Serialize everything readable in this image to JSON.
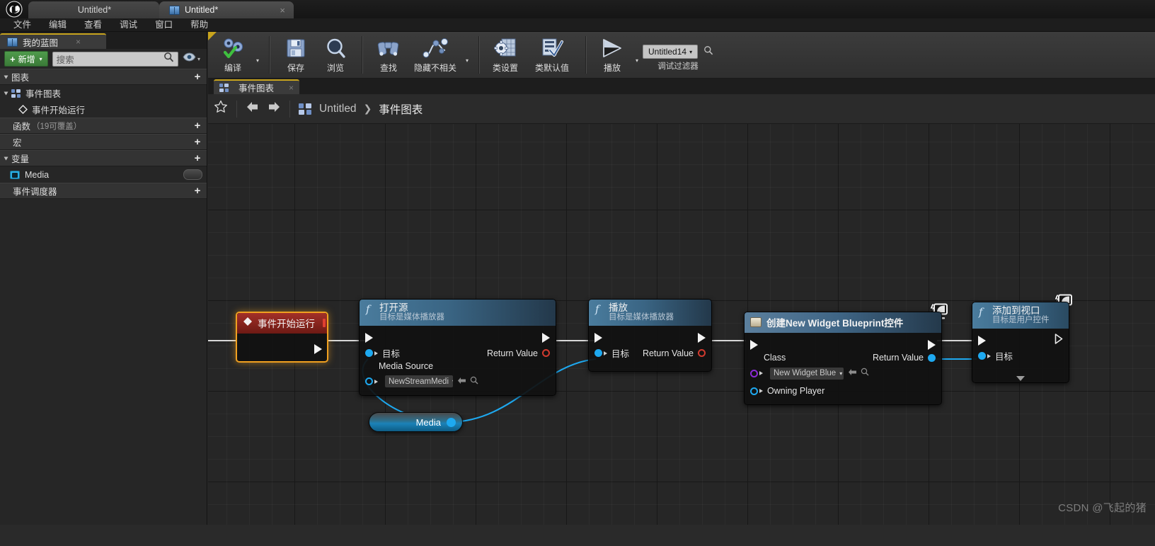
{
  "app": {
    "logo_icon": "unreal-engine-logo",
    "window_tabs": [
      {
        "label": "Untitled*",
        "icon": "unreal-window-icon",
        "active": false
      },
      {
        "label": "Untitled*",
        "icon": "blueprint-book-icon",
        "active": true,
        "close": "×"
      }
    ]
  },
  "menubar": {
    "items": [
      "文件",
      "编辑",
      "查看",
      "调试",
      "窗口",
      "帮助"
    ]
  },
  "left_panel": {
    "tab": {
      "label": "我的蓝图",
      "icon": "blueprint-book-icon",
      "close": "×"
    },
    "add_button": {
      "label": "新增",
      "plus": "+",
      "caret": "▾"
    },
    "search": {
      "placeholder": "搜索",
      "icon": "search-icon"
    },
    "eye": {
      "icon": "eye-icon",
      "caret": "▾"
    },
    "sections": [
      {
        "name": "graphs",
        "label": "图表",
        "plus": "+"
      },
      {
        "name": "event-graph",
        "label": "事件图表",
        "icon": "event-graph-icon"
      },
      {
        "name": "event-begin-play",
        "label": "事件开始运行",
        "icon": "event-node-icon"
      },
      {
        "name": "functions",
        "label": "函数",
        "note": "（19可覆盖）",
        "plus": "+"
      },
      {
        "name": "macros",
        "label": "宏",
        "plus": "+"
      },
      {
        "name": "variables",
        "label": "变量",
        "plus": "+"
      },
      {
        "name": "variable-media",
        "label": "Media",
        "icon": "media-player-icon"
      },
      {
        "name": "event-dispatchers",
        "label": "事件调度器",
        "plus": "+"
      }
    ]
  },
  "toolbar": {
    "buttons": [
      {
        "name": "compile",
        "label": "编译",
        "icon": "compile-gears-check-icon",
        "caret": "▾"
      },
      {
        "name": "save",
        "label": "保存",
        "icon": "save-floppy-icon"
      },
      {
        "name": "browse",
        "label": "浏览",
        "icon": "browse-magnifier-icon"
      },
      {
        "name": "find",
        "label": "查找",
        "icon": "find-binoculars-icon"
      },
      {
        "name": "hide-unrelated",
        "label": "隐藏不相关",
        "icon": "hide-unrelated-nodes-icon",
        "caret": "▾"
      },
      {
        "name": "class-settings",
        "label": "类设置",
        "icon": "class-settings-icon"
      },
      {
        "name": "class-defaults",
        "label": "类默认值",
        "icon": "class-defaults-icon"
      },
      {
        "name": "play",
        "label": "播放",
        "icon": "play-triangle-icon",
        "caret": "▾"
      }
    ],
    "debug": {
      "value": "Untitled14",
      "caret": "▾",
      "label": "调试过滤器",
      "search_icon": "search-icon"
    }
  },
  "graph_tab": {
    "label": "事件图表",
    "icon": "event-graph-icon",
    "close": "×"
  },
  "breadcrumb": {
    "star_icon": "favorite-star-icon",
    "back_icon": "back-arrow-icon",
    "forward_icon": "forward-arrow-icon",
    "graph_icon": "event-graph-icon",
    "root": "Untitled",
    "chevron": "❯",
    "current": "事件图表"
  },
  "graph": {
    "watermark": "CSDN @飞起的猪",
    "nodes": [
      {
        "name": "event-begin-play-node",
        "title": "事件开始运行",
        "header_icon": "event-diamond-icon",
        "badge_icon": "red-square-icon",
        "selected": true
      },
      {
        "name": "open-source-node",
        "title": "打开源",
        "subtitle": "目标是媒体播放器",
        "header_icon": "function-f-icon",
        "pins": {
          "target": "目标",
          "media_source": "Media Source",
          "return_value": "Return Value"
        },
        "media_source_value": "NewStreamMedi",
        "caret": "▾",
        "mini_icons": [
          "use-selected-asset-icon",
          "browse-to-asset-icon"
        ]
      },
      {
        "name": "play-node",
        "title": "播放",
        "subtitle": "目标是媒体播放器",
        "header_icon": "function-f-icon",
        "pins": {
          "target": "目标",
          "return_value": "Return Value"
        }
      },
      {
        "name": "create-widget-node",
        "title": "创建New Widget Blueprint控件",
        "header_icon": "widget-blueprint-icon",
        "pins": {
          "class": "Class",
          "owning_player": "Owning Player",
          "return_value": "Return Value"
        },
        "class_value": "New Widget Blue",
        "caret": "▾",
        "mini_icons": [
          "use-selected-asset-icon",
          "browse-to-asset-icon"
        ]
      },
      {
        "name": "add-to-viewport-node",
        "title": "添加到视口",
        "subtitle": "目标是用户控件",
        "header_icon": "function-f-icon",
        "pins": {
          "target": "目标"
        },
        "expander_icon": "expand-arrow-icon"
      }
    ],
    "variable_getters": [
      {
        "name": "media-getter-node",
        "label": "Media",
        "pin": "blue-object-pin"
      }
    ],
    "debug_badges": [
      {
        "name": "debug-monitor-badge-1",
        "icon": "debug-monitor-icon"
      },
      {
        "name": "debug-monitor-badge-2",
        "icon": "debug-monitor-icon"
      }
    ]
  },
  "colors": {
    "accent_yellow": "#c8a41d",
    "exec_wire": "#d8d8d8",
    "data_wire": "#1ea9f0",
    "selection": "#f0a020",
    "node_header_blue": "#3f6d8e",
    "event_header_red": "#8e2119",
    "add_button_green": "#4f9b4c"
  }
}
